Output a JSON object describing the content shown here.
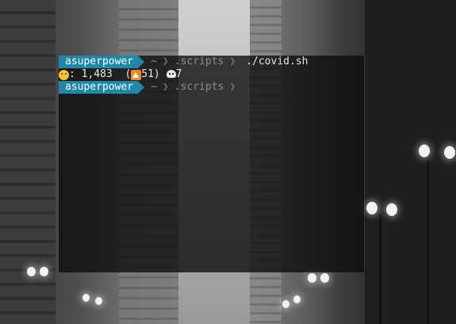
{
  "prompt1": {
    "user": "asuperpower",
    "home": "~",
    "dir": ".scripts",
    "command": "./covid.sh"
  },
  "output": {
    "cases_separator": ": ",
    "cases": "1,483",
    "delta_open": "(",
    "delta": "51)",
    "deaths": "7"
  },
  "prompt2": {
    "user": "asuperpower",
    "home": "~",
    "dir": ".scripts"
  },
  "icons": {
    "cases": "worried-face-icon",
    "delta": "up-arrow-icon",
    "deaths": "skull-icon"
  }
}
